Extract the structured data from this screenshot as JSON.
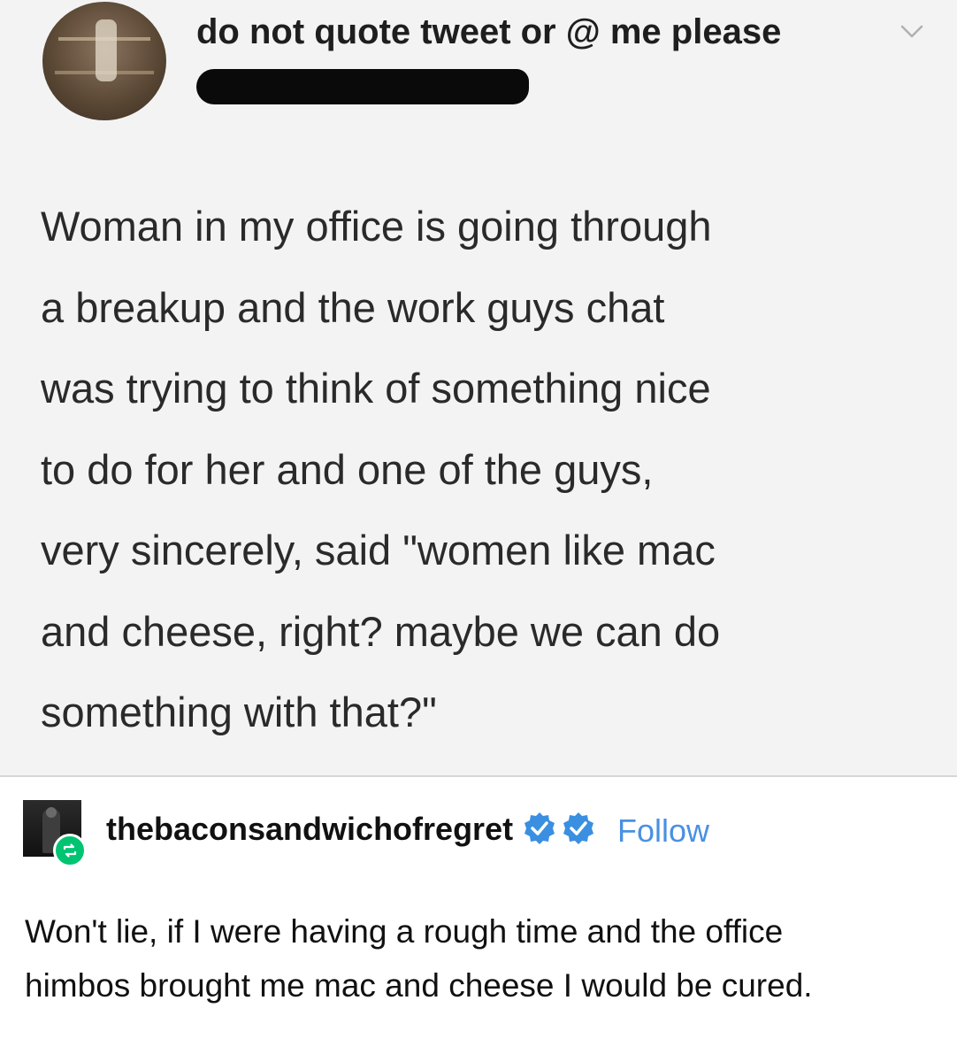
{
  "tweet": {
    "display_name": "do not quote tweet or @ me please",
    "body_lines": [
      "Woman in my office is going through",
      "a breakup and the work guys chat",
      "was trying to think of something nice",
      "to do for her and one of the guys,",
      "very sincerely, said \"women like mac",
      "and cheese, right? maybe we can do",
      "something with that?\""
    ]
  },
  "reblog": {
    "username": "thebaconsandwichofregret",
    "follow_label": "Follow",
    "body_lines": [
      "Won't lie, if I were having a rough time and the office",
      "himbos brought me mac and cheese I would be cured."
    ]
  },
  "icons": {
    "avatar": "profile-photo",
    "chevron": "chevron-down-icon",
    "verified": "verified-badge-icon",
    "reblog": "reblog-icon"
  },
  "colors": {
    "follow": "#4a90e2",
    "verified": "#3b8fe0",
    "reblog_badge": "#00c472",
    "tweet_bg": "#f3f3f3"
  }
}
